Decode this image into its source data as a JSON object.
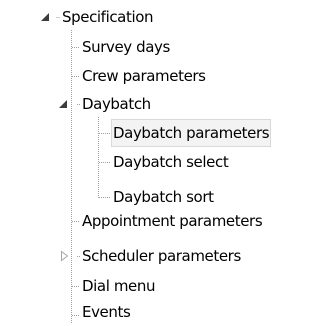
{
  "tree": {
    "items": [
      {
        "label": "Specification",
        "state": "expanded"
      },
      {
        "label": "Survey days",
        "state": "leaf"
      },
      {
        "label": "Crew parameters",
        "state": "leaf"
      },
      {
        "label": "Daybatch",
        "state": "expanded"
      },
      {
        "label": "Daybatch parameters",
        "state": "leaf",
        "selected": true
      },
      {
        "label": "Daybatch select",
        "state": "leaf"
      },
      {
        "label": "Daybatch sort",
        "state": "leaf"
      },
      {
        "label": "Appointment parameters",
        "state": "leaf"
      },
      {
        "label": "Scheduler parameters",
        "state": "collapsed"
      },
      {
        "label": "Dial menu",
        "state": "leaf"
      },
      {
        "label": "Events",
        "state": "leaf"
      }
    ]
  },
  "colors": {
    "expanded_arrow": "#3c3c3c",
    "collapsed_arrow": "#a6a6a6",
    "tree_line": "#a0a0a0",
    "selection_bg": "#f3f3f3",
    "selection_border": "#d9d9d9"
  },
  "icons": {
    "expanded": "expanded-triangle-icon",
    "collapsed": "collapsed-triangle-icon"
  }
}
